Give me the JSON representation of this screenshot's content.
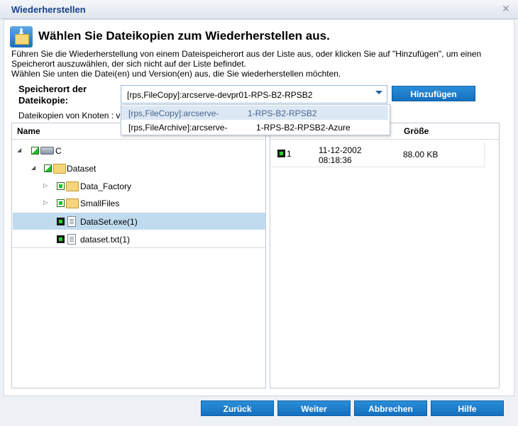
{
  "dialog": {
    "title": "Wiederherstellen",
    "heading": "Wählen Sie Dateikopien zum Wiederherstellen aus.",
    "desc_line1": "Führen Sie die Wiederherstellung von einem Dateispeicherort aus der Liste aus, oder klicken Sie auf \"Hinzufügen\", um einen",
    "desc_line2": "Speicherort auszuwählen, der sich nicht auf der Liste befindet.",
    "desc_line3": "Wählen Sie unten die Datei(en) und Version(en) aus, die Sie wiederherstellen möchten."
  },
  "location": {
    "label_line1": "Speicherort der",
    "label_line2": "Dateikopie:",
    "selected": "[rps,FileCopy]:arcserve-devpr01-RPS-B2-RPSB2",
    "options": [
      {
        "left": "[rps,FileCopy]:arcserve-",
        "right": "1-RPS-B2-RPSB2"
      },
      {
        "left": "[rps,FileArchive]:arcserve-",
        "right": "1-RPS-B2-RPSB2-Azure"
      }
    ],
    "add_button": "Hinzufügen"
  },
  "nodes_label": "Dateikopien von Knoten : v",
  "tree": {
    "column_name": "Name",
    "items": [
      {
        "label": "C"
      },
      {
        "label": "Dataset"
      },
      {
        "label": "Data_Factory"
      },
      {
        "label": "SmallFiles"
      },
      {
        "label": "DataSet.exe(1)"
      },
      {
        "label": "dataset.txt(1)"
      }
    ]
  },
  "versions": {
    "column_size": "Größe",
    "rows": [
      {
        "version": "1",
        "date": "11-12-2002",
        "time": "08:18:36",
        "size": "88.00 KB"
      }
    ]
  },
  "buttons": {
    "back": "Zurück",
    "next": "Weiter",
    "cancel": "Abbrechen",
    "help": "Hilfe"
  },
  "colors": {
    "accent": "#1570c0",
    "title": "#15428b",
    "selection": "#c0dbee"
  },
  "icons": {
    "close": "close-icon",
    "header": "folder-restore-icon"
  }
}
